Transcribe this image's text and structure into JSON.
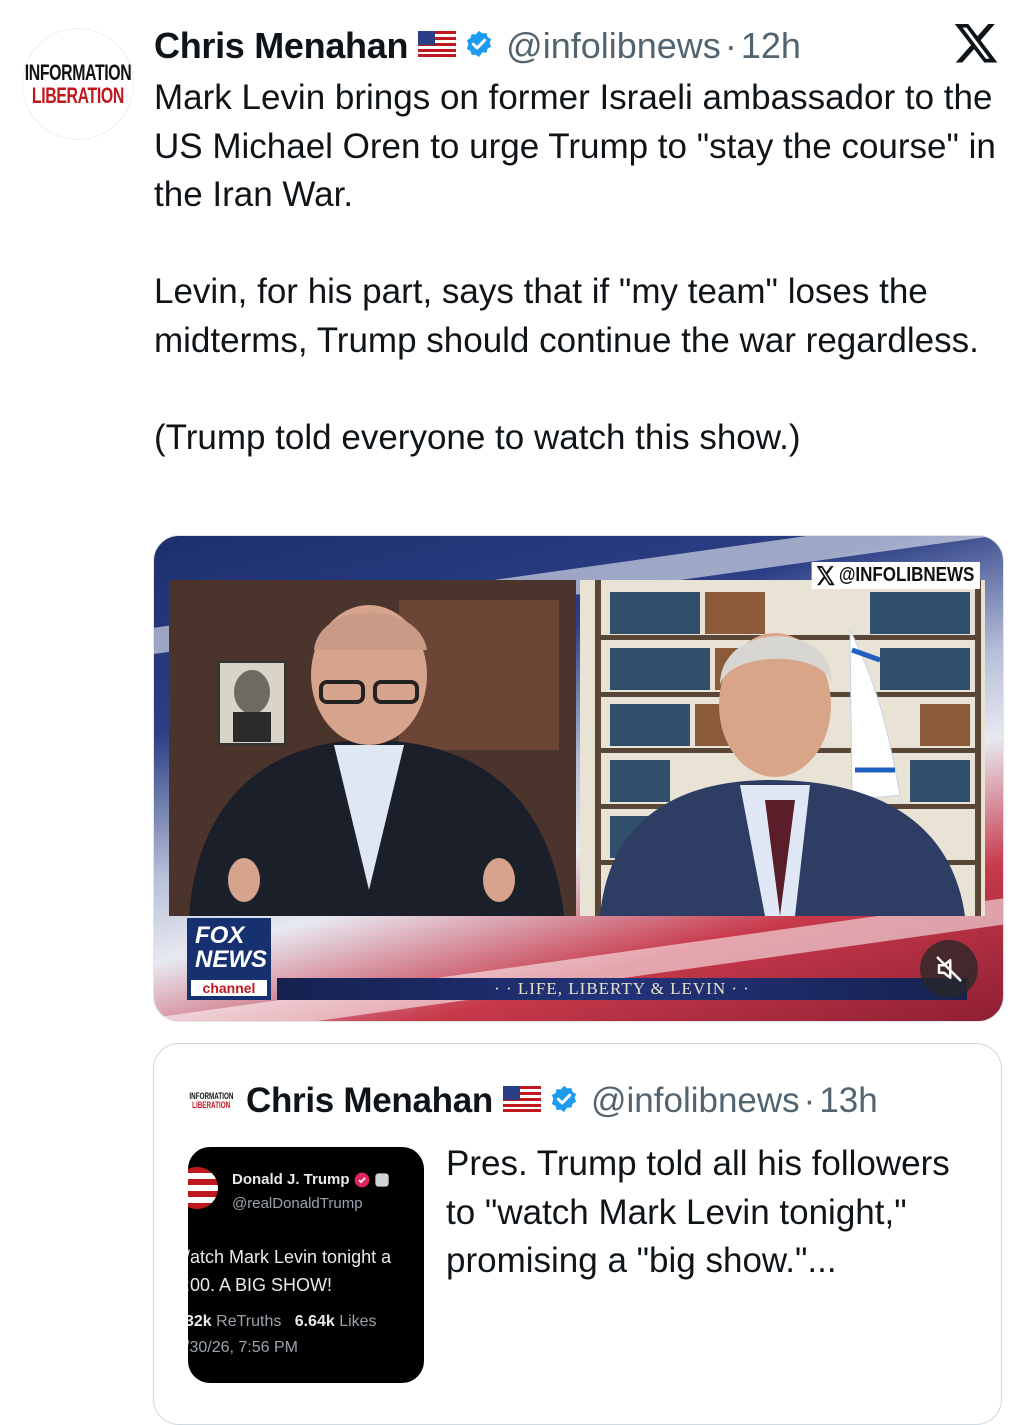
{
  "tweet": {
    "avatar": {
      "line1": "INFORMATION",
      "line2": "LIBERATION"
    },
    "author_name": "Chris Menahan",
    "handle": "@infolibnews",
    "separator": "·",
    "time": "12h",
    "text": "Mark Levin brings on former Israeli ambassador to the US Michael Oren to urge Trump to \"stay the course\" in the Iran War.\n\nLevin, for his part, says that if \"my team\" loses the midterms, Trump should continue the war regardless.\n\n(Trump told everyone to watch this show.)"
  },
  "media": {
    "watermark": "@INFOLIBNEWS",
    "network_line1": "FOX",
    "network_line2": "NEWS",
    "network_line3": "channel",
    "show_banner": "· · LIFE, LIBERTY & LEVIN · ·",
    "mute_icon": "speaker-muted-icon"
  },
  "quoted": {
    "avatar": {
      "line1": "INFORMATION",
      "line2": "LIBERATION"
    },
    "author_name": "Chris Menahan",
    "handle": "@infolibnews",
    "separator": "·",
    "time": "13h",
    "text": "Pres. Trump told all his followers to \"watch Mark Levin tonight,\" promising a \"big show.\"...",
    "thumbnail": {
      "name": "Donald J. Trump",
      "handle": "@realDonaldTrump",
      "line1": "/atch Mark Levin tonight a",
      "line2": ":00. A BIG SHOW!",
      "retruths_count": "32k",
      "retruths_label": "ReTruths",
      "likes_count": "6.64k",
      "likes_label": "Likes",
      "date": "/30/26, 7:56 PM"
    }
  },
  "colors": {
    "verified": "#1d9bf0",
    "secondary_text": "#536471",
    "brand_red": "#c0181f"
  }
}
